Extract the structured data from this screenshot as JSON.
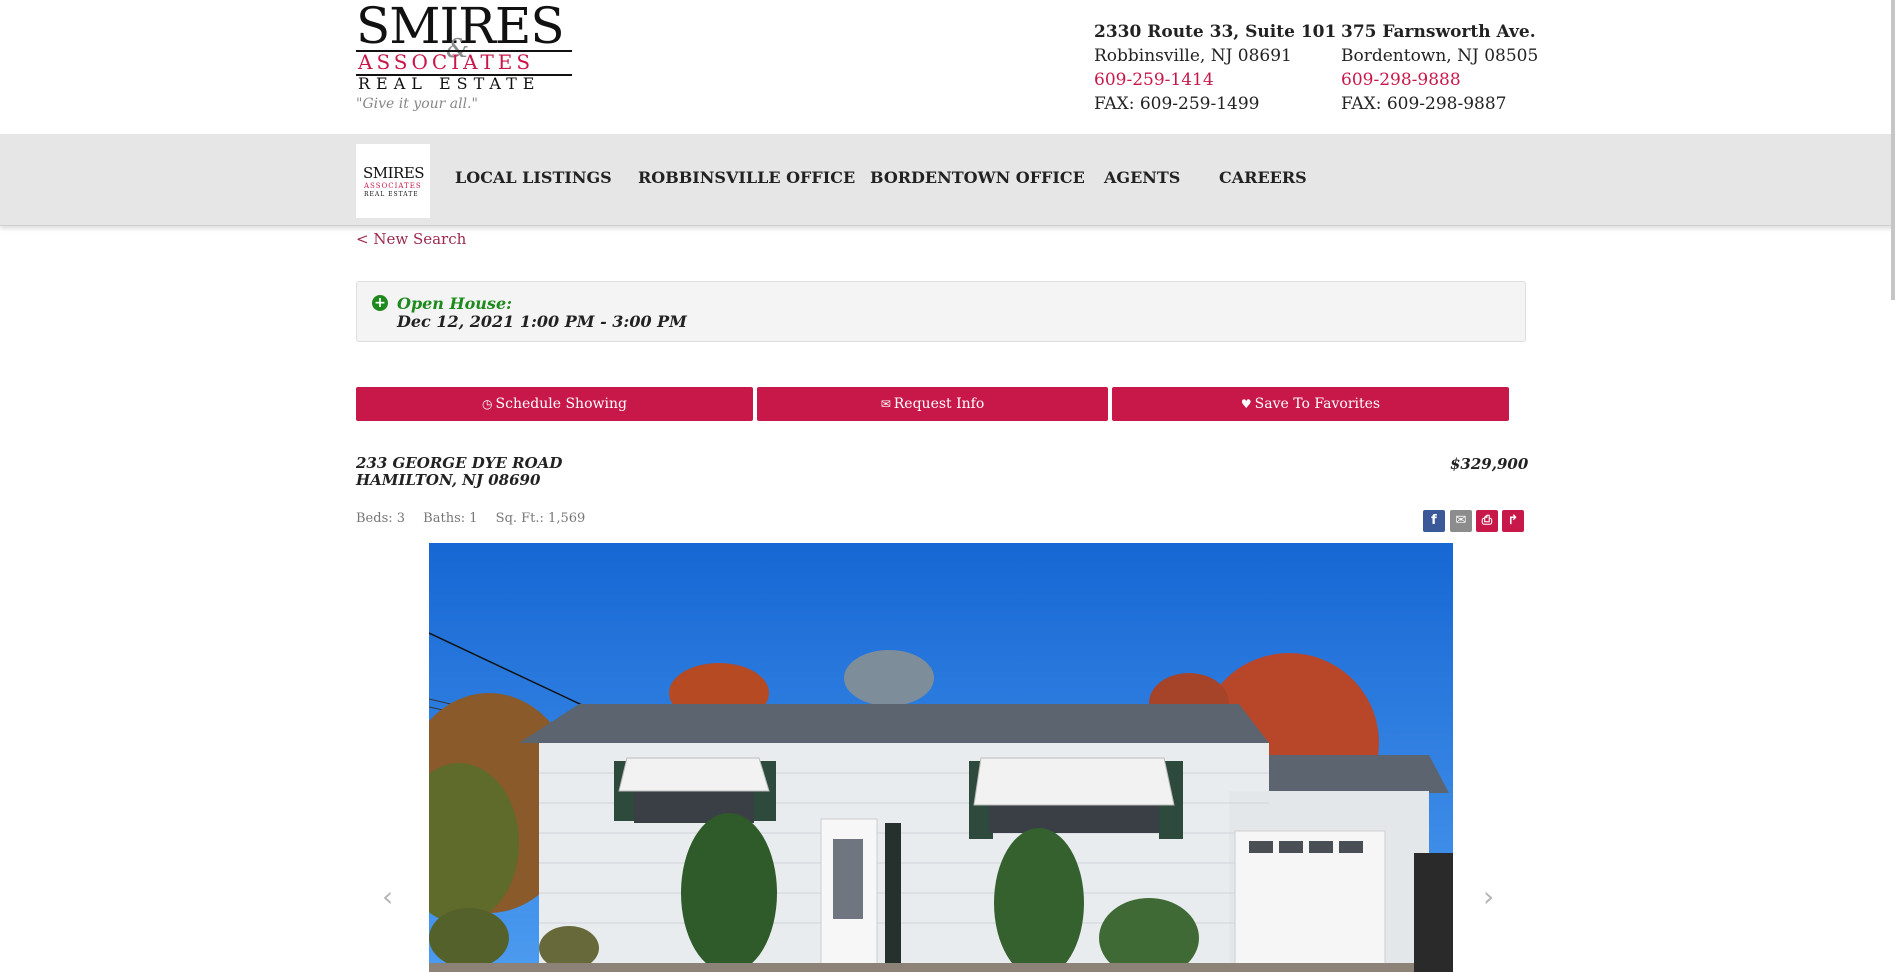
{
  "brand": {
    "logo_line1": "SMIRES",
    "logo_amp": "&",
    "logo_line2": "ASSOCIATES",
    "logo_line3": "REAL ESTATE",
    "tagline": "\"Give it your all.\"",
    "colors": {
      "accent": "#c8184a",
      "nav_bg": "#e6e6e6",
      "open_house_green": "#1e8a1e"
    }
  },
  "offices": [
    {
      "name": "2330 Route 33, Suite 101",
      "city": "Robbinsville, NJ 08691",
      "phone": "609-259-1414",
      "fax": "FAX: 609-259-1499"
    },
    {
      "name": "375 Farnsworth Ave.",
      "city": "Bordentown, NJ 08505",
      "phone": "609-298-9888",
      "fax": "FAX: 609-298-9887"
    }
  ],
  "nav": {
    "items": [
      "LOCAL LISTINGS",
      "ROBBINSVILLE OFFICE",
      "BORDENTOWN OFFICE",
      "AGENTS",
      "CAREERS"
    ]
  },
  "new_search": "< New Search",
  "open_house": {
    "icon": "plus-circle-icon",
    "label": "Open House:",
    "when": "Dec 12, 2021 1:00 PM - 3:00 PM"
  },
  "actions": {
    "schedule": {
      "icon": "clock-icon",
      "label": "Schedule Showing"
    },
    "request": {
      "icon": "envelope-icon",
      "label": "Request Info"
    },
    "favorite": {
      "icon": "heart-icon",
      "label": "Save To Favorites"
    }
  },
  "listing": {
    "street": "233 GEORGE DYE ROAD",
    "city": "HAMILTON, NJ 08690",
    "price": "$329,900",
    "beds": "Beds: 3",
    "baths": "Baths: 1",
    "sqft": "Sq. Ft.: 1,569"
  },
  "share_icons": [
    "facebook-icon",
    "email-icon",
    "print-icon",
    "share-icon"
  ]
}
